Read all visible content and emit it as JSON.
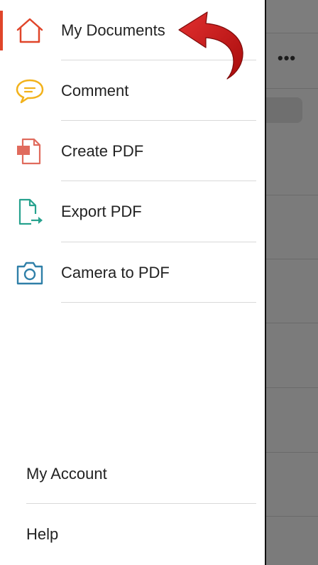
{
  "menu": {
    "items": [
      {
        "label": "My Documents",
        "icon": "home-icon",
        "active": true
      },
      {
        "label": "Comment",
        "icon": "comment-icon"
      },
      {
        "label": "Create PDF",
        "icon": "create-pdf-icon"
      },
      {
        "label": "Export PDF",
        "icon": "export-pdf-icon"
      },
      {
        "label": "Camera to PDF",
        "icon": "camera-icon"
      }
    ]
  },
  "footer": {
    "items": [
      {
        "label": "My Account"
      },
      {
        "label": "Help"
      }
    ]
  },
  "background": {
    "more_label": "•••"
  },
  "colors": {
    "accent": "#e0452a",
    "comment": "#f2b21b",
    "create": "#e06b5d",
    "export": "#27a28e",
    "camera": "#2f7fa8",
    "overlay": "#7b7b7b",
    "annotation_arrow": "#cc1111"
  }
}
